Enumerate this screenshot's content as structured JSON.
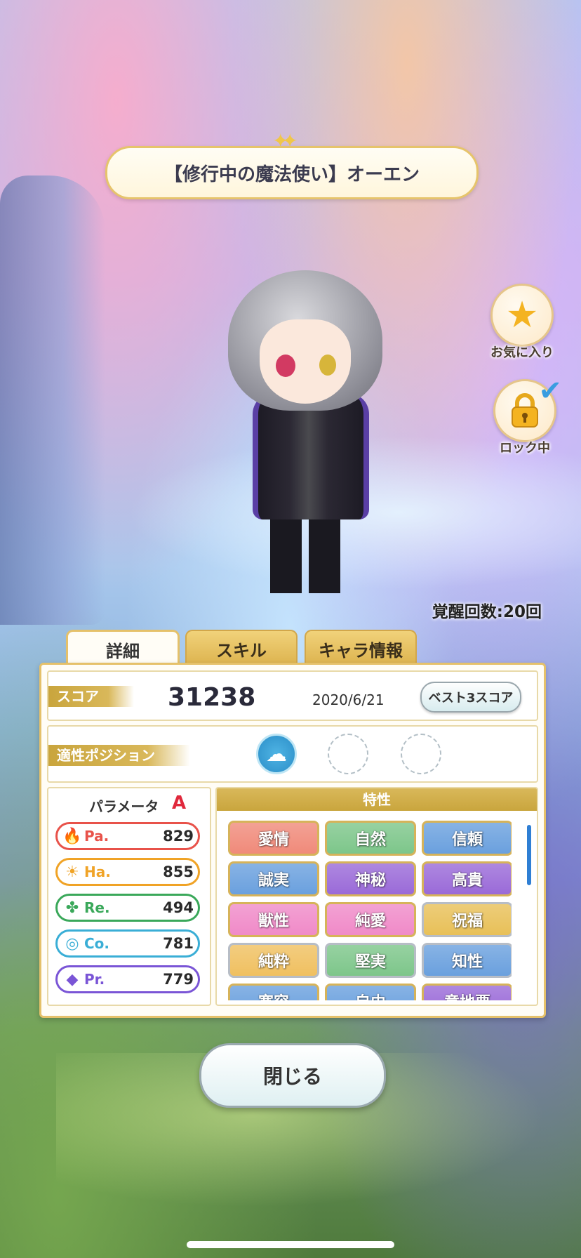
{
  "card": {
    "title": "【修行中の魔法使い】オーエン"
  },
  "side_buttons": {
    "favorite_label": "お気に入り",
    "lock_label": "ロック中"
  },
  "awaken_text": "覚醒回数:20回",
  "tabs": [
    {
      "label": "詳細",
      "active": true
    },
    {
      "label": "スキル",
      "active": false
    },
    {
      "label": "キャラ情報",
      "active": false
    }
  ],
  "score": {
    "label": "スコア",
    "value": "31238",
    "date": "2020/6/21",
    "best_button": "ベスト3スコア"
  },
  "position": {
    "label": "適性ポジション"
  },
  "parameters": {
    "header": "パラメータ",
    "rank": "A",
    "rows": [
      {
        "name": "Pa.",
        "value": "829",
        "color": "#e8524a",
        "icon": "flame-icon",
        "glyph": "🔥"
      },
      {
        "name": "Ha.",
        "value": "855",
        "color": "#f0a326",
        "icon": "sun-icon",
        "glyph": "☀"
      },
      {
        "name": "Re.",
        "value": "494",
        "color": "#3aa85a",
        "icon": "clover-icon",
        "glyph": "✤"
      },
      {
        "name": "Co.",
        "value": "781",
        "color": "#3aaed6",
        "icon": "planet-icon",
        "glyph": "◎"
      },
      {
        "name": "Pr.",
        "value": "779",
        "color": "#7a55d6",
        "icon": "diamond-icon",
        "glyph": "◆"
      }
    ]
  },
  "traits": {
    "header": "特性",
    "items": [
      {
        "label": "愛情",
        "color": "#f08a7a"
      },
      {
        "label": "自然",
        "color": "#7dc68a"
      },
      {
        "label": "信頼",
        "color": "#6aa0de"
      },
      {
        "label": "誠実",
        "color": "#6aa0de"
      },
      {
        "label": "神秘",
        "color": "#9a6ad8"
      },
      {
        "label": "高貴",
        "color": "#9a6ad8"
      },
      {
        "label": "獣性",
        "color": "#f08ac8"
      },
      {
        "label": "純愛",
        "color": "#f08ac8"
      },
      {
        "label": "祝福",
        "color": "#e8c058"
      },
      {
        "label": "純粋",
        "color": "#f0c060"
      },
      {
        "label": "堅実",
        "color": "#7dc68a"
      },
      {
        "label": "知性",
        "color": "#6aa0de"
      },
      {
        "label": "寛容",
        "color": "#6aa0de"
      },
      {
        "label": "自由",
        "color": "#6aa0de"
      },
      {
        "label": "意地悪",
        "color": "#9a6ad8"
      }
    ]
  },
  "close_button": "閉じる",
  "colors": {
    "accent_gold": "#d9b85a",
    "checkmark": "#3a9de0",
    "rank": "#e0283c"
  }
}
